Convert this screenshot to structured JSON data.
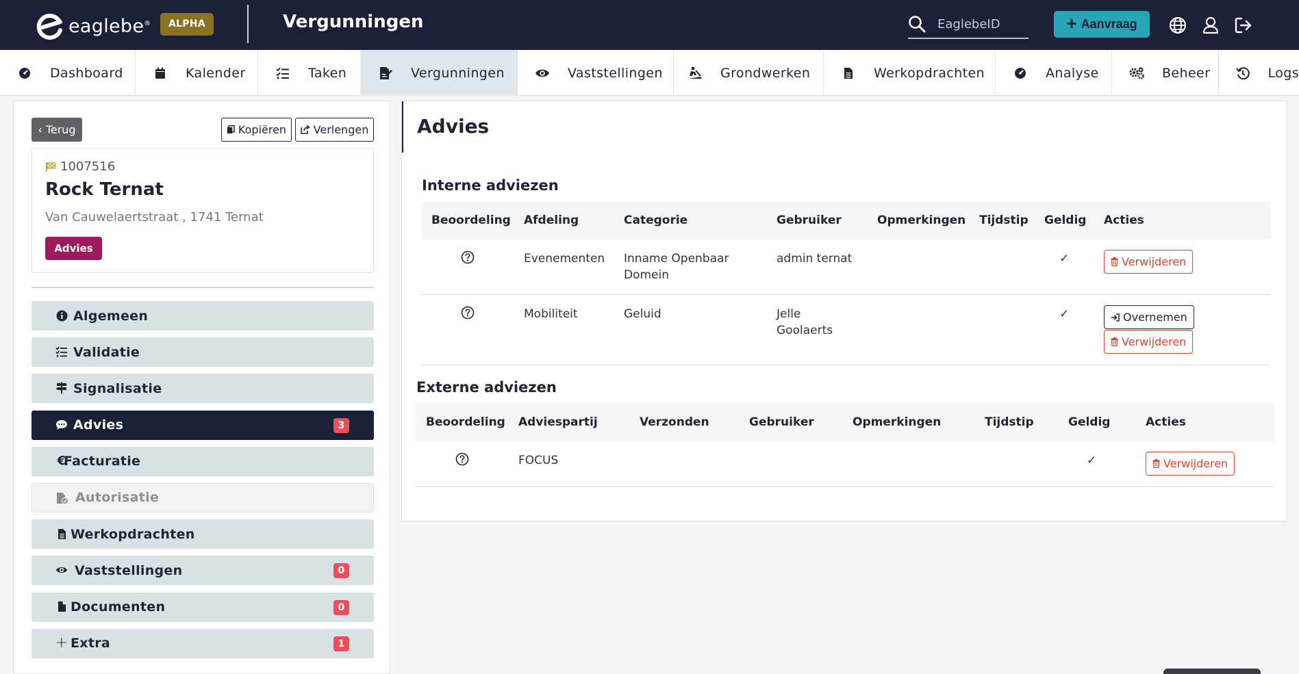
{
  "brand": {
    "name": "eaglebe",
    "mark": "®",
    "stage_badge": "ALPHA"
  },
  "header": {
    "title": "Vergunningen",
    "search_placeholder": "EaglebeID",
    "new_button": "Aanvraag",
    "icons": [
      "globe-icon",
      "user-icon",
      "logout-icon"
    ]
  },
  "nav": {
    "items": [
      {
        "label": "Dashboard",
        "icon": "dashboard-icon"
      },
      {
        "label": "Kalender",
        "icon": "calendar-icon"
      },
      {
        "label": "Taken",
        "icon": "tasks-icon"
      },
      {
        "label": "Vergunningen",
        "icon": "permit-icon",
        "active": true
      },
      {
        "label": "Vaststellingen",
        "icon": "eye-icon"
      },
      {
        "label": "Grondwerken",
        "icon": "digging-icon"
      },
      {
        "label": "Werkopdrachten",
        "icon": "file-icon"
      },
      {
        "label": "Analyse",
        "icon": "gauge-icon"
      },
      {
        "label": "Beheer",
        "icon": "cogs-icon"
      },
      {
        "label": "Logs",
        "icon": "history-icon"
      }
    ]
  },
  "record": {
    "back_label": "Terug",
    "copy_label": "Kopiëren",
    "extend_label": "Verlengen",
    "number": "1007516",
    "name": "Rock Ternat",
    "address": "Van Cauwelaertstraat , 1741 Ternat",
    "status": "Advies"
  },
  "sidebar": {
    "items": [
      {
        "label": "Algemeen",
        "icon": "info-icon"
      },
      {
        "label": "Validatie",
        "icon": "checklist-icon"
      },
      {
        "label": "Signalisatie",
        "icon": "signpost-icon"
      },
      {
        "label": "Advies",
        "icon": "comment-icon",
        "count": "3",
        "active": true
      },
      {
        "label": "Facturatie",
        "icon": "euro-icon"
      },
      {
        "label": "Autorisatie",
        "icon": "file-check-icon",
        "disabled": true
      },
      {
        "label": "Werkopdrachten",
        "icon": "file-icon"
      },
      {
        "label": "Vaststellingen",
        "icon": "eye-icon",
        "count": "0"
      },
      {
        "label": "Documenten",
        "icon": "document-icon",
        "count": "0"
      },
      {
        "label": "Extra",
        "icon": "plus-icon",
        "count": "1"
      }
    ]
  },
  "advies": {
    "title": "Advies",
    "intern": {
      "title": "Interne adviezen",
      "columns": [
        "Beoordeling",
        "Afdeling",
        "Categorie",
        "Gebruiker",
        "Opmerkingen",
        "Tijdstip",
        "Geldig",
        "Acties"
      ],
      "rows": [
        {
          "afdeling": "Evenementen",
          "categorie": "Inname Openbaar Domein",
          "gebruiker": "admin ternat",
          "opmerkingen": "",
          "tijdstip": "",
          "geldig": "✓",
          "actions": [
            "Verwijderen"
          ]
        },
        {
          "afdeling": "Mobiliteit",
          "categorie": "Geluid",
          "gebruiker": "Jelle Goolaerts",
          "opmerkingen": "",
          "tijdstip": "",
          "geldig": "✓",
          "actions": [
            "Overnemen",
            "Verwijderen"
          ]
        }
      ]
    },
    "extern": {
      "title": "Externe adviezen",
      "columns": [
        "Beoordeling",
        "Adviespartij",
        "Verzonden",
        "Gebruiker",
        "Opmerkingen",
        "Tijdstip",
        "Geldig",
        "Acties"
      ],
      "rows": [
        {
          "adviespartij": "FOCUS",
          "verzonden": "",
          "gebruiker": "",
          "opmerkingen": "",
          "tijdstip": "",
          "geldig": "✓",
          "actions": [
            "Verwijderen"
          ]
        }
      ]
    }
  },
  "colors": {
    "topbar": "#1b2038",
    "accent": "#2aa5b6",
    "alpha_badge": "#8a7223",
    "status_badge": "#9c1b5b",
    "count_badge": "#ee4d5c",
    "delete": "#d9442e",
    "menu_bg": "#d8e1e4"
  }
}
